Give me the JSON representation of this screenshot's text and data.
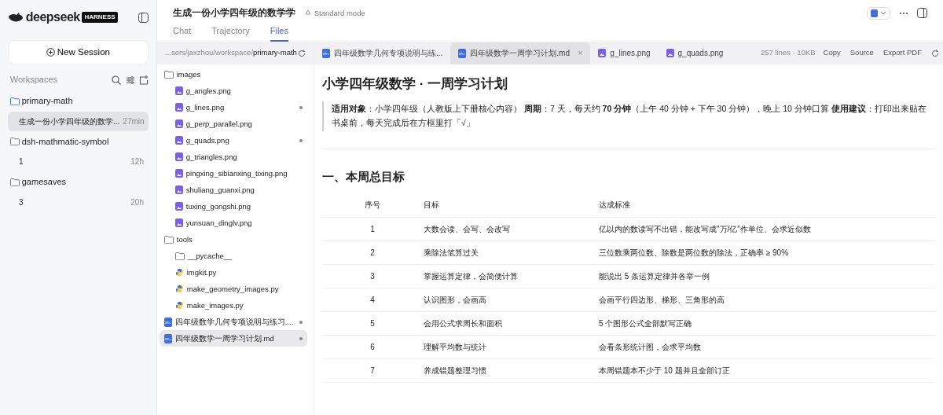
{
  "sidebar": {
    "brand": "deepseek",
    "brand_badge": "HARNESS",
    "new_session": "New Session",
    "workspaces_label": "Workspaces",
    "workspaces": [
      {
        "name": "primary-math",
        "selected": true,
        "sessions": [
          {
            "title": "生成一份小学四年级的数学...",
            "age": "27min",
            "selected": true
          }
        ]
      },
      {
        "name": "dsh-mathmatic-symbol",
        "selected": false,
        "sessions": [
          {
            "title": "1",
            "age": "12h",
            "selected": false
          }
        ]
      },
      {
        "name": "gamesaves",
        "selected": false,
        "sessions": [
          {
            "title": "3",
            "age": "20h",
            "selected": false
          }
        ]
      }
    ]
  },
  "header": {
    "title": "生成一份小学四年级的数学学",
    "mode": "Standard mode",
    "tabs": [
      {
        "label": "Chat",
        "selected": false
      },
      {
        "label": "Trajectory",
        "selected": false
      },
      {
        "label": "Files",
        "selected": true
      }
    ]
  },
  "path": {
    "prefix": "...sers/jaxzhou/workspace/",
    "current": "primary-math"
  },
  "tree": [
    {
      "name": "images",
      "kind": "folder",
      "children": [
        {
          "name": "g_angles.png",
          "kind": "image",
          "modified": false
        },
        {
          "name": "g_lines.png",
          "kind": "image",
          "modified": true
        },
        {
          "name": "g_perp_parallel.png",
          "kind": "image",
          "modified": false
        },
        {
          "name": "g_quads.png",
          "kind": "image",
          "modified": true
        },
        {
          "name": "g_triangles.png",
          "kind": "image",
          "modified": false
        },
        {
          "name": "pingxing_sibianxing_tixing.png",
          "kind": "image",
          "modified": false
        },
        {
          "name": "shuliang_guanxi.png",
          "kind": "image",
          "modified": false
        },
        {
          "name": "tuxing_gongshi.png",
          "kind": "image",
          "modified": false
        },
        {
          "name": "yunsuan_dinglv.png",
          "kind": "image",
          "modified": false
        }
      ]
    },
    {
      "name": "tools",
      "kind": "folder",
      "children": [
        {
          "name": "__pycache__",
          "kind": "folder"
        },
        {
          "name": "imgkit.py",
          "kind": "python",
          "modified": false
        },
        {
          "name": "make_geometry_images.py",
          "kind": "python",
          "modified": false
        },
        {
          "name": "make_images.py",
          "kind": "python",
          "modified": false
        }
      ]
    },
    {
      "name": "四年级数学几何专项说明与练习....",
      "kind": "markdown",
      "modified": true,
      "selected": false
    },
    {
      "name": "四年级数学一周学习计划.md",
      "kind": "markdown",
      "modified": true,
      "selected": true
    }
  ],
  "file_tabs": [
    {
      "name": "四年级数学几何专项说明与练...",
      "kind": "markdown",
      "selected": false
    },
    {
      "name": "四年级数学一周学习计划.md",
      "kind": "markdown",
      "selected": true,
      "close": "×"
    },
    {
      "name": "g_lines.png",
      "kind": "image",
      "selected": false
    },
    {
      "name": "g_quads.png",
      "kind": "image",
      "selected": false
    }
  ],
  "file_info": "257 lines · 10KB",
  "actions": [
    "Copy",
    "Source",
    "Export PDF"
  ],
  "doc": {
    "title": "小学四年级数学 · 一周学习计划",
    "intro": "**适用对象**：小学四年级（人教版上下册核心内容） **周期**：7 天，每天约 **70 分钟**（上午 40 分钟 + 下午 30 分钟），晚上 10 分钟口算 **使用建议**：打印出来贴在书桌前，每天完成后在方框里打「√」",
    "section": "一、本周总目标",
    "table": {
      "columns": [
        "序号",
        "目标",
        "达成标准"
      ],
      "rows": [
        [
          "1",
          "大数会读、会写、会改写",
          "亿以内的数读写不出错，能改写成\"万/亿\"作单位、会求近似数"
        ],
        [
          "2",
          "乘除法笔算过关",
          "三位数乘两位数、除数是两位数的除法，正确率 ≥ 90%"
        ],
        [
          "3",
          "掌握运算定律，会简便计算",
          "能说出 5 条运算定律并各举一例"
        ],
        [
          "4",
          "认识图形，会画高",
          "会画平行四边形、梯形、三角形的高"
        ],
        [
          "5",
          "会用公式求周长和面积",
          "5 个图形公式全部默写正确"
        ],
        [
          "6",
          "理解平均数与统计",
          "会看条形统计图，会求平均数"
        ],
        [
          "7",
          "养成错题整理习惯",
          "本周错题本不少于 10 题并且全部订正"
        ]
      ]
    }
  }
}
